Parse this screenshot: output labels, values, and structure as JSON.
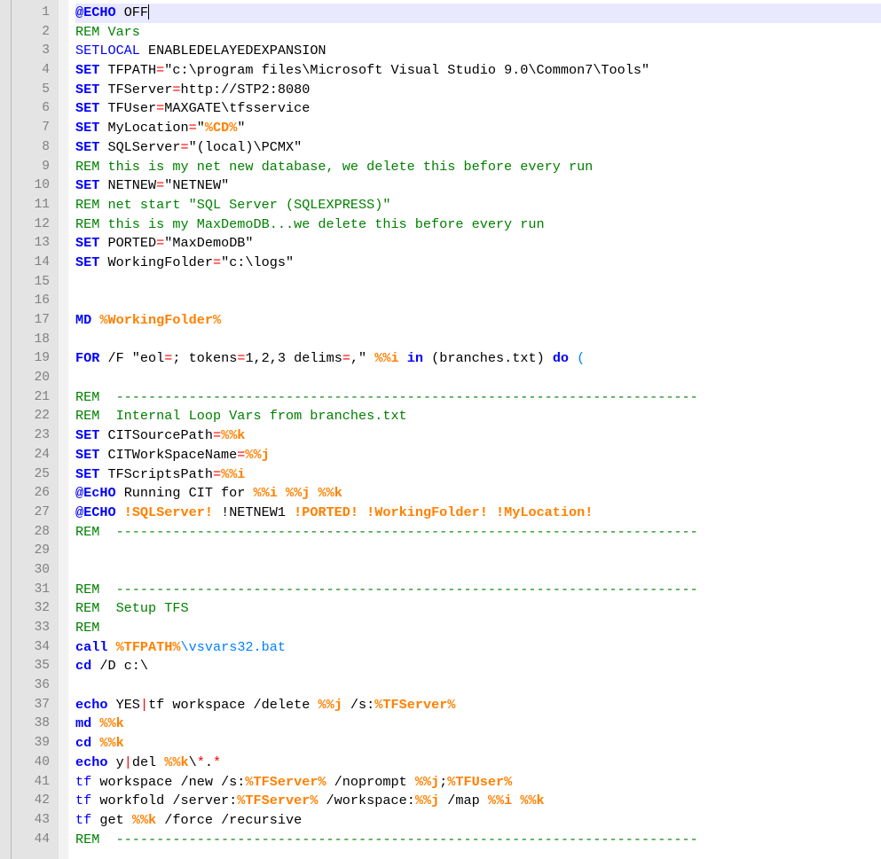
{
  "editor": {
    "language": "batch",
    "current_line": 1,
    "colors": {
      "keyword": "#0000ff",
      "comment": "#008000",
      "variable": "#ff8000",
      "operator": "#ff0000",
      "line_number": "#808080",
      "gutter": "#e4e4e4",
      "current_line": "#e8e8ff"
    },
    "lines": [
      {
        "n": "1",
        "tokens": [
          {
            "t": "kw",
            "v": "@ECHO"
          },
          {
            "t": "text",
            "v": " OFF"
          }
        ]
      },
      {
        "n": "2",
        "tokens": [
          {
            "t": "rem",
            "v": "REM Vars"
          }
        ]
      },
      {
        "n": "3",
        "tokens": [
          {
            "t": "kwplain",
            "v": "SETLOCAL"
          },
          {
            "t": "text",
            "v": " ENABLEDELAYEDEXPANSION"
          }
        ]
      },
      {
        "n": "4",
        "tokens": [
          {
            "t": "kw",
            "v": "SET"
          },
          {
            "t": "text",
            "v": " TFPATH"
          },
          {
            "t": "op",
            "v": "="
          },
          {
            "t": "text",
            "v": "\"c:\\program files\\Microsoft Visual Studio 9.0\\Common7\\Tools\""
          }
        ]
      },
      {
        "n": "5",
        "tokens": [
          {
            "t": "kw",
            "v": "SET"
          },
          {
            "t": "text",
            "v": " TFServer"
          },
          {
            "t": "op",
            "v": "="
          },
          {
            "t": "text",
            "v": "http://STP2:8080"
          }
        ]
      },
      {
        "n": "6",
        "tokens": [
          {
            "t": "kw",
            "v": "SET"
          },
          {
            "t": "text",
            "v": " TFUser"
          },
          {
            "t": "op",
            "v": "="
          },
          {
            "t": "text",
            "v": "MAXGATE\\tfsservice"
          }
        ]
      },
      {
        "n": "7",
        "tokens": [
          {
            "t": "kw",
            "v": "SET"
          },
          {
            "t": "text",
            "v": " MyLocation"
          },
          {
            "t": "op",
            "v": "="
          },
          {
            "t": "text",
            "v": "\""
          },
          {
            "t": "var",
            "v": "%CD%"
          },
          {
            "t": "text",
            "v": "\""
          }
        ]
      },
      {
        "n": "8",
        "tokens": [
          {
            "t": "kw",
            "v": "SET"
          },
          {
            "t": "text",
            "v": " SQLServer"
          },
          {
            "t": "op",
            "v": "="
          },
          {
            "t": "text",
            "v": "\"(local)\\PCMX\""
          }
        ]
      },
      {
        "n": "9",
        "tokens": [
          {
            "t": "rem",
            "v": "REM this is my net new database, we delete this before every run"
          }
        ]
      },
      {
        "n": "10",
        "tokens": [
          {
            "t": "kw",
            "v": "SET"
          },
          {
            "t": "text",
            "v": " NETNEW"
          },
          {
            "t": "op",
            "v": "="
          },
          {
            "t": "text",
            "v": "\"NETNEW\""
          }
        ]
      },
      {
        "n": "11",
        "tokens": [
          {
            "t": "rem",
            "v": "REM net start \"SQL Server (SQLEXPRESS)\""
          }
        ]
      },
      {
        "n": "12",
        "tokens": [
          {
            "t": "rem",
            "v": "REM this is my MaxDemoDB...we delete this before every run"
          }
        ]
      },
      {
        "n": "13",
        "tokens": [
          {
            "t": "kw",
            "v": "SET"
          },
          {
            "t": "text",
            "v": " PORTED"
          },
          {
            "t": "op",
            "v": "="
          },
          {
            "t": "text",
            "v": "\"MaxDemoDB\""
          }
        ]
      },
      {
        "n": "14",
        "tokens": [
          {
            "t": "kw",
            "v": "SET"
          },
          {
            "t": "text",
            "v": " WorkingFolder"
          },
          {
            "t": "op",
            "v": "="
          },
          {
            "t": "text",
            "v": "\"c:\\logs\""
          }
        ]
      },
      {
        "n": "15",
        "tokens": []
      },
      {
        "n": "16",
        "tokens": []
      },
      {
        "n": "17",
        "tokens": [
          {
            "t": "kw",
            "v": "MD"
          },
          {
            "t": "text",
            "v": " "
          },
          {
            "t": "var",
            "v": "%WorkingFolder%"
          }
        ]
      },
      {
        "n": "18",
        "tokens": []
      },
      {
        "n": "19",
        "tokens": [
          {
            "t": "kw",
            "v": "FOR"
          },
          {
            "t": "text",
            "v": " /F \"eol"
          },
          {
            "t": "op",
            "v": "="
          },
          {
            "t": "text",
            "v": "; tokens"
          },
          {
            "t": "op",
            "v": "="
          },
          {
            "t": "text",
            "v": "1,2,3 delims"
          },
          {
            "t": "op",
            "v": "="
          },
          {
            "t": "text",
            "v": ",\" "
          },
          {
            "t": "var",
            "v": "%%i"
          },
          {
            "t": "text",
            "v": " "
          },
          {
            "t": "kw",
            "v": "in"
          },
          {
            "t": "text",
            "v": " (branches.txt) "
          },
          {
            "t": "kw",
            "v": "do"
          },
          {
            "t": "text",
            "v": " "
          },
          {
            "t": "cmd",
            "v": "("
          }
        ]
      },
      {
        "n": "20",
        "tokens": []
      },
      {
        "n": "21",
        "tokens": [
          {
            "t": "rem",
            "v": "REM  ------------------------------------------------------------------------"
          }
        ]
      },
      {
        "n": "22",
        "tokens": [
          {
            "t": "rem",
            "v": "REM  Internal Loop Vars from branches.txt"
          }
        ]
      },
      {
        "n": "23",
        "tokens": [
          {
            "t": "kw",
            "v": "SET"
          },
          {
            "t": "text",
            "v": " CITSourcePath"
          },
          {
            "t": "op",
            "v": "="
          },
          {
            "t": "var",
            "v": "%%k"
          }
        ]
      },
      {
        "n": "24",
        "tokens": [
          {
            "t": "kw",
            "v": "SET"
          },
          {
            "t": "text",
            "v": " CITWorkSpaceName"
          },
          {
            "t": "op",
            "v": "="
          },
          {
            "t": "var",
            "v": "%%j"
          }
        ]
      },
      {
        "n": "25",
        "tokens": [
          {
            "t": "kw",
            "v": "SET"
          },
          {
            "t": "text",
            "v": " TFScriptsPath"
          },
          {
            "t": "op",
            "v": "="
          },
          {
            "t": "var",
            "v": "%%i"
          }
        ]
      },
      {
        "n": "26",
        "tokens": [
          {
            "t": "kw",
            "v": "@EcHO"
          },
          {
            "t": "text",
            "v": " Running CIT for "
          },
          {
            "t": "var",
            "v": "%%i"
          },
          {
            "t": "text",
            "v": " "
          },
          {
            "t": "var",
            "v": "%%j"
          },
          {
            "t": "text",
            "v": " "
          },
          {
            "t": "var",
            "v": "%%k"
          }
        ]
      },
      {
        "n": "27",
        "tokens": [
          {
            "t": "kw",
            "v": "@ECHO"
          },
          {
            "t": "text",
            "v": " "
          },
          {
            "t": "var",
            "v": "!SQLServer!"
          },
          {
            "t": "text",
            "v": " !NETNEW1 "
          },
          {
            "t": "var",
            "v": "!PORTED!"
          },
          {
            "t": "text",
            "v": " "
          },
          {
            "t": "var",
            "v": "!WorkingFolder!"
          },
          {
            "t": "text",
            "v": " "
          },
          {
            "t": "var",
            "v": "!MyLocation!"
          }
        ]
      },
      {
        "n": "28",
        "tokens": [
          {
            "t": "rem",
            "v": "REM  ------------------------------------------------------------------------"
          }
        ]
      },
      {
        "n": "29",
        "tokens": []
      },
      {
        "n": "30",
        "tokens": []
      },
      {
        "n": "31",
        "tokens": [
          {
            "t": "rem",
            "v": "REM  ------------------------------------------------------------------------"
          }
        ]
      },
      {
        "n": "32",
        "tokens": [
          {
            "t": "rem",
            "v": "REM  Setup TFS"
          }
        ]
      },
      {
        "n": "33",
        "tokens": [
          {
            "t": "rem",
            "v": "REM"
          }
        ]
      },
      {
        "n": "34",
        "tokens": [
          {
            "t": "kw",
            "v": "call"
          },
          {
            "t": "text",
            "v": " "
          },
          {
            "t": "var",
            "v": "%TFPATH%"
          },
          {
            "t": "cmd",
            "v": "\\vsvars32.bat"
          }
        ]
      },
      {
        "n": "35",
        "tokens": [
          {
            "t": "kw",
            "v": "cd"
          },
          {
            "t": "text",
            "v": " /D c:\\"
          }
        ]
      },
      {
        "n": "36",
        "tokens": []
      },
      {
        "n": "37",
        "tokens": [
          {
            "t": "kw",
            "v": "echo"
          },
          {
            "t": "text",
            "v": " YES"
          },
          {
            "t": "op",
            "v": "|"
          },
          {
            "t": "text",
            "v": "tf workspace /delete "
          },
          {
            "t": "var",
            "v": "%%j"
          },
          {
            "t": "text",
            "v": " /s:"
          },
          {
            "t": "var",
            "v": "%TFServer%"
          }
        ]
      },
      {
        "n": "38",
        "tokens": [
          {
            "t": "kw",
            "v": "md"
          },
          {
            "t": "text",
            "v": " "
          },
          {
            "t": "var",
            "v": "%%k"
          }
        ]
      },
      {
        "n": "39",
        "tokens": [
          {
            "t": "kw",
            "v": "cd"
          },
          {
            "t": "text",
            "v": " "
          },
          {
            "t": "var",
            "v": "%%k"
          }
        ]
      },
      {
        "n": "40",
        "tokens": [
          {
            "t": "kw",
            "v": "echo"
          },
          {
            "t": "text",
            "v": " y"
          },
          {
            "t": "op",
            "v": "|"
          },
          {
            "t": "text",
            "v": "del "
          },
          {
            "t": "var",
            "v": "%%k"
          },
          {
            "t": "text",
            "v": "\\"
          },
          {
            "t": "op",
            "v": "*"
          },
          {
            "t": "text",
            "v": "."
          },
          {
            "t": "op",
            "v": "*"
          }
        ]
      },
      {
        "n": "41",
        "tokens": [
          {
            "t": "kwplain",
            "v": "tf"
          },
          {
            "t": "text",
            "v": " workspace /new /s:"
          },
          {
            "t": "var",
            "v": "%TFServer%"
          },
          {
            "t": "text",
            "v": " /noprompt "
          },
          {
            "t": "var",
            "v": "%%j"
          },
          {
            "t": "text",
            "v": ";"
          },
          {
            "t": "var",
            "v": "%TFUser%"
          }
        ]
      },
      {
        "n": "42",
        "tokens": [
          {
            "t": "kwplain",
            "v": "tf"
          },
          {
            "t": "text",
            "v": " workfold /server:"
          },
          {
            "t": "var",
            "v": "%TFServer%"
          },
          {
            "t": "text",
            "v": " /workspace:"
          },
          {
            "t": "var",
            "v": "%%j"
          },
          {
            "t": "text",
            "v": " /map "
          },
          {
            "t": "var",
            "v": "%%i"
          },
          {
            "t": "text",
            "v": " "
          },
          {
            "t": "var",
            "v": "%%k"
          }
        ]
      },
      {
        "n": "43",
        "tokens": [
          {
            "t": "kwplain",
            "v": "tf"
          },
          {
            "t": "text",
            "v": " get "
          },
          {
            "t": "var",
            "v": "%%k"
          },
          {
            "t": "text",
            "v": " /force /recursive"
          }
        ]
      },
      {
        "n": "44",
        "tokens": [
          {
            "t": "rem",
            "v": "REM  ------------------------------------------------------------------------"
          }
        ]
      }
    ]
  }
}
